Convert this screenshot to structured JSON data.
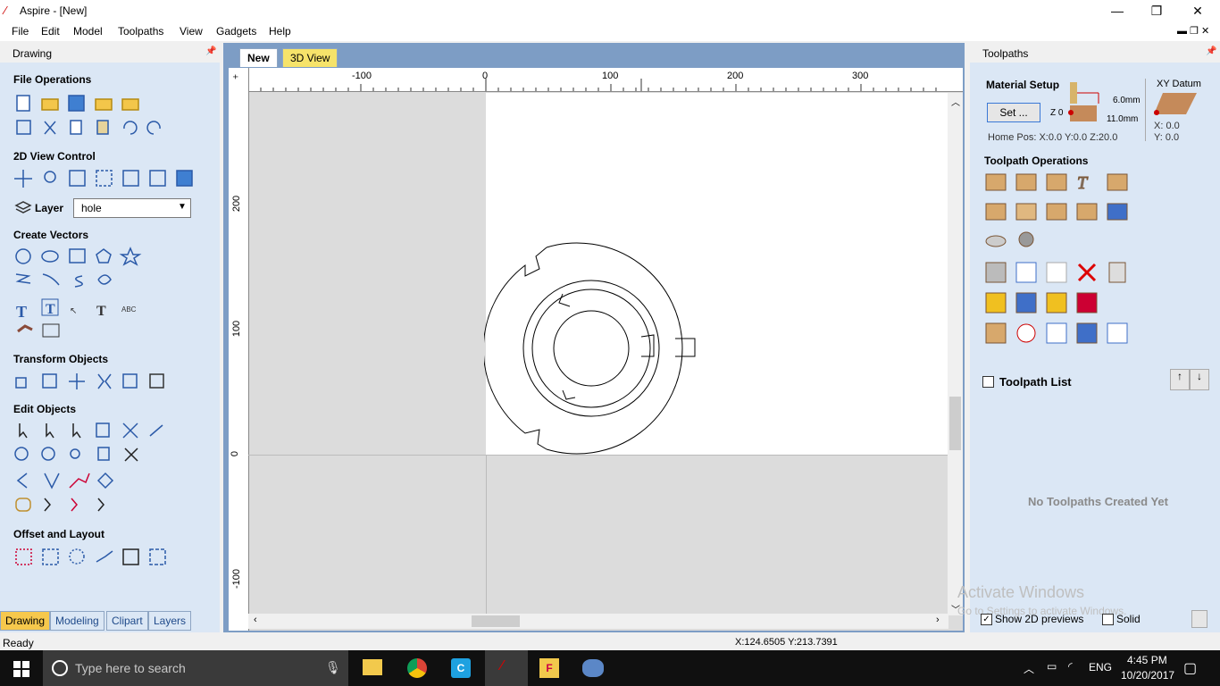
{
  "window": {
    "title": "Aspire - [New]"
  },
  "menu": [
    "File",
    "Edit",
    "Model",
    "Toolpaths",
    "View",
    "Gadgets",
    "Help"
  ],
  "left_panel": {
    "title": "Drawing",
    "sections": {
      "file_operations": "File Operations",
      "view_control": "2D View Control",
      "layer_label": "Layer",
      "layer_value": "hole",
      "create_vectors": "Create Vectors",
      "transform_objects": "Transform Objects",
      "edit_objects": "Edit Objects",
      "offset_layout": "Offset and Layout"
    },
    "bottom_tabs": [
      "Drawing",
      "Modeling",
      "Clipart",
      "Layers"
    ]
  },
  "view": {
    "tabs": [
      "New",
      "3D View"
    ],
    "ruler_x": [
      "-100",
      "0",
      "100",
      "200",
      "300"
    ],
    "ruler_y": [
      "200",
      "100",
      "0",
      "-100"
    ]
  },
  "right_panel": {
    "title": "Toolpaths",
    "material_setup": "Material Setup",
    "set_button": "Set ...",
    "z0": "Z 0",
    "dim1": "6.0mm",
    "dim2": "11.0mm",
    "xy_datum": "XY Datum",
    "home_pos": "Home Pos:   X:0.0 Y:0.0 Z:20.0",
    "datum_x": "X: 0.0",
    "datum_y": "Y: 0.0",
    "toolpath_operations": "Toolpath Operations",
    "toolpath_list": "Toolpath List",
    "no_toolpaths": "No Toolpaths Created Yet",
    "show_2d": "Show 2D previews",
    "solid": "Solid"
  },
  "watermark": {
    "line1": "Activate Windows",
    "line2": "Go to Settings to activate Windows."
  },
  "status": {
    "left": "Ready",
    "coords": "X:124.6505 Y:213.7391"
  },
  "taskbar": {
    "search_placeholder": "Type here to search",
    "lang": "ENG",
    "time": "4:45 PM",
    "date": "10/20/2017"
  }
}
